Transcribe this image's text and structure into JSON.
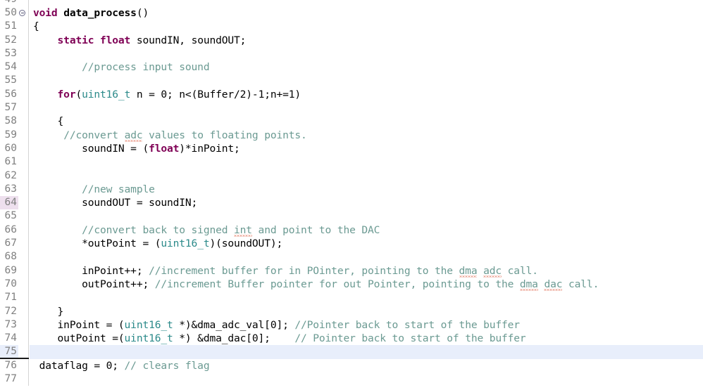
{
  "editor": {
    "kind": "source-code-editor",
    "language": "C",
    "current_line": 75,
    "marked_line": 64,
    "fold_marker_line": 50,
    "first_visible_line": 49,
    "last_visible_line": 77,
    "colors": {
      "background": "#ffffff",
      "gutter_text": "#808080",
      "keyword": "#7f0055",
      "type": "#2b8a8a",
      "comment": "#6b9a92",
      "plain_text": "#000000",
      "current_line_highlight": "#e8eefb",
      "marked_line_gutter": "#eee0ee",
      "spellcheck_squiggle": "#d94a2b"
    }
  },
  "lines": [
    {
      "num": "49",
      "clipped": true,
      "tokens": []
    },
    {
      "num": "50",
      "fold": true,
      "tokens": [
        {
          "t": "void",
          "c": "kw"
        },
        {
          "t": " ",
          "c": "pln"
        },
        {
          "t": "data_process",
          "c": "fn"
        },
        {
          "t": "()",
          "c": "pln"
        }
      ]
    },
    {
      "num": "51",
      "tokens": [
        {
          "t": "{",
          "c": "pln"
        }
      ]
    },
    {
      "num": "52",
      "tokens": [
        {
          "t": "    ",
          "c": "pln"
        },
        {
          "t": "static",
          "c": "kw"
        },
        {
          "t": " ",
          "c": "pln"
        },
        {
          "t": "float",
          "c": "kw"
        },
        {
          "t": " soundIN, soundOUT;",
          "c": "pln"
        }
      ]
    },
    {
      "num": "53",
      "tokens": []
    },
    {
      "num": "54",
      "tokens": [
        {
          "t": "        ",
          "c": "pln"
        },
        {
          "t": "//process input sound",
          "c": "cmt"
        }
      ]
    },
    {
      "num": "55",
      "tokens": []
    },
    {
      "num": "56",
      "tokens": [
        {
          "t": "    ",
          "c": "pln"
        },
        {
          "t": "for",
          "c": "kw"
        },
        {
          "t": "(",
          "c": "pln"
        },
        {
          "t": "uint16_t",
          "c": "typ"
        },
        {
          "t": " n = 0; n<(Buffer/2)-1;n+=1)",
          "c": "pln"
        }
      ]
    },
    {
      "num": "57",
      "tokens": []
    },
    {
      "num": "58",
      "tokens": [
        {
          "t": "    {",
          "c": "pln"
        }
      ]
    },
    {
      "num": "59",
      "tokens": [
        {
          "t": "     ",
          "c": "pln"
        },
        {
          "t": "//convert ",
          "c": "cmt"
        },
        {
          "t": "adc",
          "c": "cmt",
          "squiggle": true
        },
        {
          "t": " values to floating points.",
          "c": "cmt"
        }
      ]
    },
    {
      "num": "60",
      "tokens": [
        {
          "t": "        soundIN = (",
          "c": "pln"
        },
        {
          "t": "float",
          "c": "kw"
        },
        {
          "t": ")*inPoint;",
          "c": "pln"
        }
      ]
    },
    {
      "num": "61",
      "tokens": []
    },
    {
      "num": "62",
      "tokens": []
    },
    {
      "num": "63",
      "tokens": [
        {
          "t": "        ",
          "c": "pln"
        },
        {
          "t": "//new sample",
          "c": "cmt"
        }
      ]
    },
    {
      "num": "64",
      "marked": true,
      "tokens": [
        {
          "t": "        soundOUT = soundIN;",
          "c": "pln"
        }
      ]
    },
    {
      "num": "65",
      "tokens": []
    },
    {
      "num": "66",
      "tokens": [
        {
          "t": "        ",
          "c": "pln"
        },
        {
          "t": "//convert back to signed ",
          "c": "cmt"
        },
        {
          "t": "int",
          "c": "cmt",
          "squiggle": true
        },
        {
          "t": " and point to the DAC",
          "c": "cmt"
        }
      ]
    },
    {
      "num": "67",
      "tokens": [
        {
          "t": "        *outPoint = (",
          "c": "pln"
        },
        {
          "t": "uint16_t",
          "c": "typ"
        },
        {
          "t": ")(soundOUT);",
          "c": "pln"
        }
      ]
    },
    {
      "num": "68",
      "tokens": []
    },
    {
      "num": "69",
      "tokens": [
        {
          "t": "        inPoint++; ",
          "c": "pln"
        },
        {
          "t": "//increment buffer for in POinter, pointing to the ",
          "c": "cmt"
        },
        {
          "t": "dma",
          "c": "cmt",
          "squiggle": true
        },
        {
          "t": " ",
          "c": "cmt"
        },
        {
          "t": "adc",
          "c": "cmt",
          "squiggle": true
        },
        {
          "t": " call.",
          "c": "cmt"
        }
      ]
    },
    {
      "num": "70",
      "tokens": [
        {
          "t": "        outPoint++; ",
          "c": "pln"
        },
        {
          "t": "//increment Buffer pointer for out Pointer, pointing to the ",
          "c": "cmt"
        },
        {
          "t": "dma",
          "c": "cmt",
          "squiggle": true
        },
        {
          "t": " ",
          "c": "cmt"
        },
        {
          "t": "dac",
          "c": "cmt",
          "squiggle": true
        },
        {
          "t": " call.",
          "c": "cmt"
        }
      ]
    },
    {
      "num": "71",
      "tokens": []
    },
    {
      "num": "72",
      "tokens": [
        {
          "t": "    }",
          "c": "pln"
        }
      ]
    },
    {
      "num": "73",
      "tokens": [
        {
          "t": "    inPoint = (",
          "c": "pln"
        },
        {
          "t": "uint16_t",
          "c": "typ"
        },
        {
          "t": " *)&dma_adc_val[0]; ",
          "c": "pln"
        },
        {
          "t": "//Pointer back to start of the buffer",
          "c": "cmt"
        }
      ]
    },
    {
      "num": "74",
      "tokens": [
        {
          "t": "    outPoint =(",
          "c": "pln"
        },
        {
          "t": "uint16_t",
          "c": "typ"
        },
        {
          "t": " *) &dma_dac[0];    ",
          "c": "pln"
        },
        {
          "t": "// Pointer back to start of the buffer",
          "c": "cmt"
        }
      ]
    },
    {
      "num": "75",
      "current": true,
      "rule": true,
      "tokens": []
    },
    {
      "num": "76",
      "tokens": [
        {
          "t": " dataflag = 0; ",
          "c": "pln"
        },
        {
          "t": "// clears flag",
          "c": "cmt"
        }
      ]
    },
    {
      "num": "77",
      "tokens": []
    }
  ]
}
